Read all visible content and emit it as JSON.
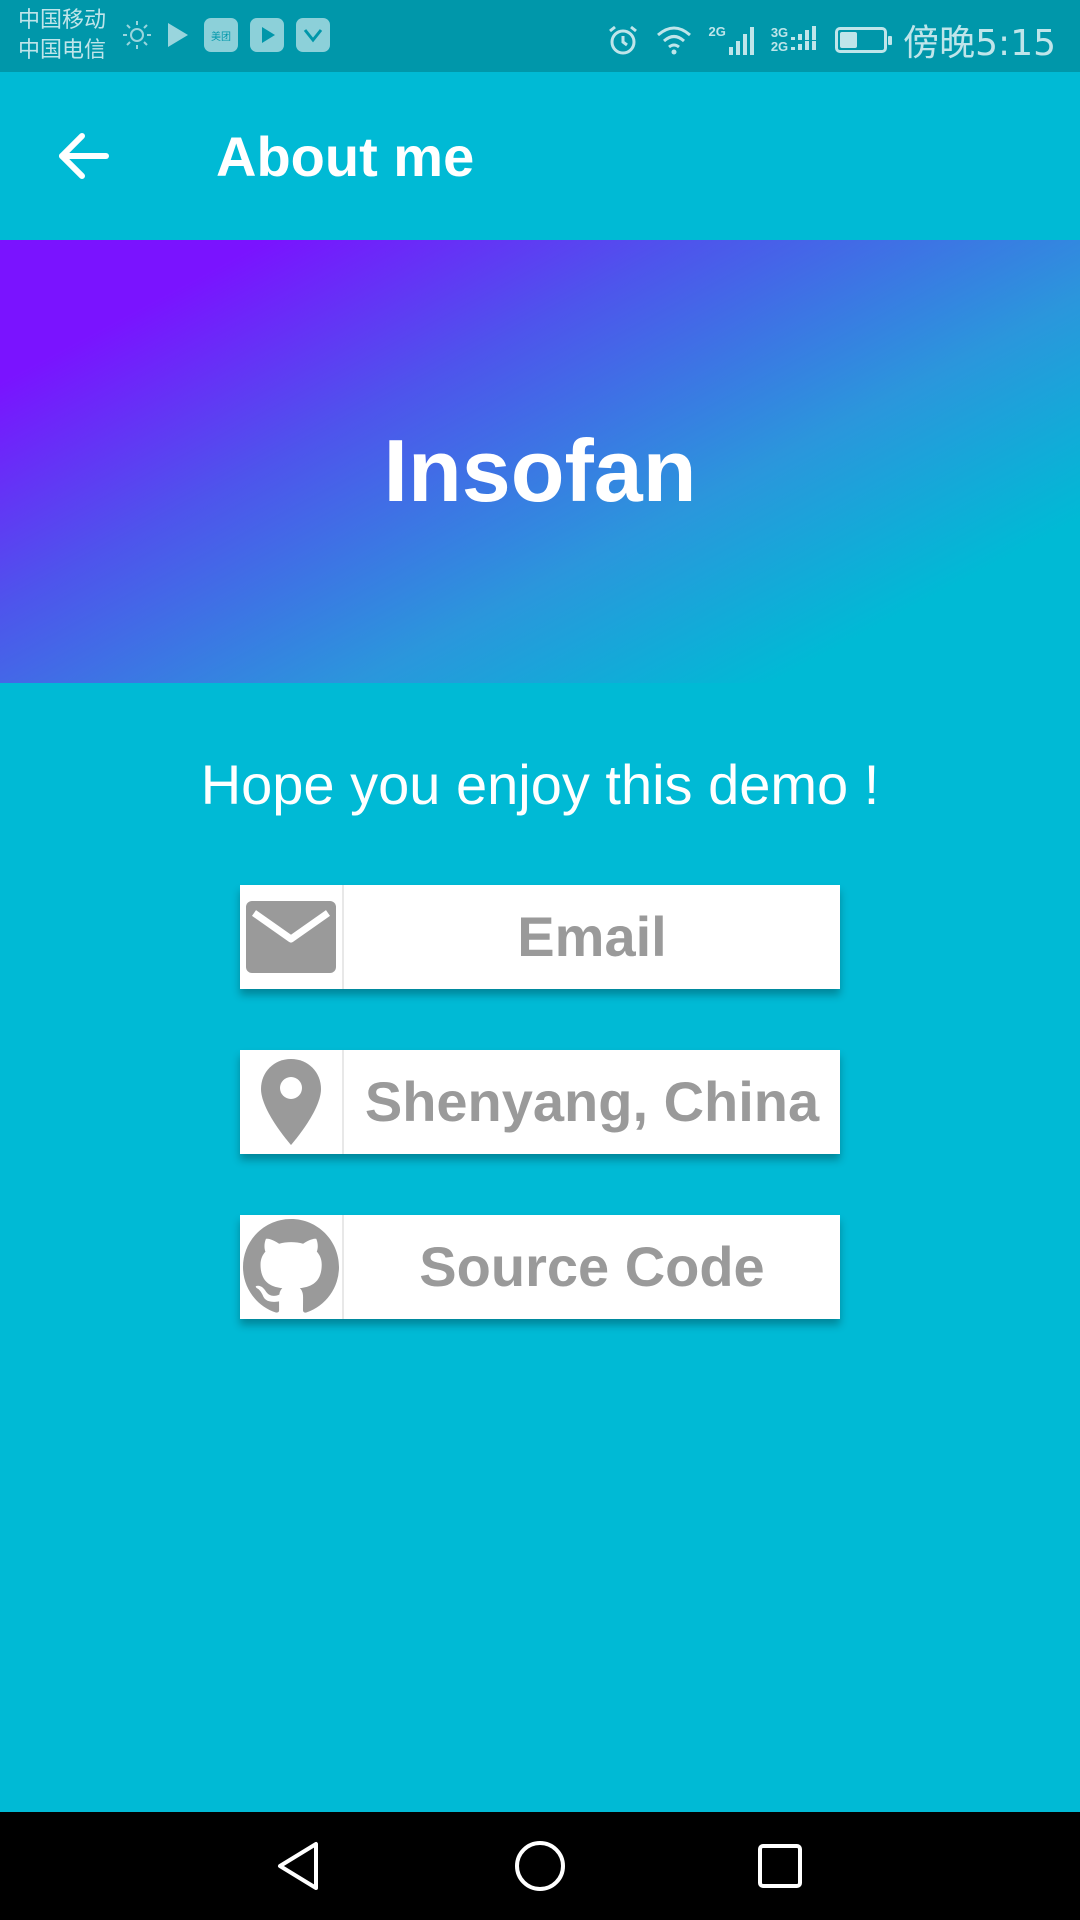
{
  "status_bar": {
    "carrier_1": "中国移动",
    "carrier_2": "中国电信",
    "time": "傍晚5:15",
    "signal_1_label": "2G",
    "signal_2_label_top": "3G",
    "signal_2_label_bottom": "2G",
    "app_icon_label": "美团",
    "battery_level": 0.4
  },
  "app_bar": {
    "title": "About me",
    "back_icon": "arrow-back-icon"
  },
  "hero": {
    "name": "Insofan"
  },
  "tagline": "Hope you enjoy this demo !",
  "cards": [
    {
      "label": "Email",
      "icon": "email-icon"
    },
    {
      "label": "Shenyang, China",
      "icon": "location-pin-icon"
    },
    {
      "label": "Source Code",
      "icon": "github-icon"
    }
  ],
  "colors": {
    "background": "#00BAD5",
    "status_bar": "#0097AA",
    "gradient_start": "#7A13FF",
    "gradient_end": "#00BAD5",
    "card_text": "#9A9A9A",
    "icon_gray": "#9A9A9A"
  },
  "nav_bar": {
    "back": "nav-back-icon",
    "home": "nav-home-icon",
    "recents": "nav-recents-icon"
  }
}
